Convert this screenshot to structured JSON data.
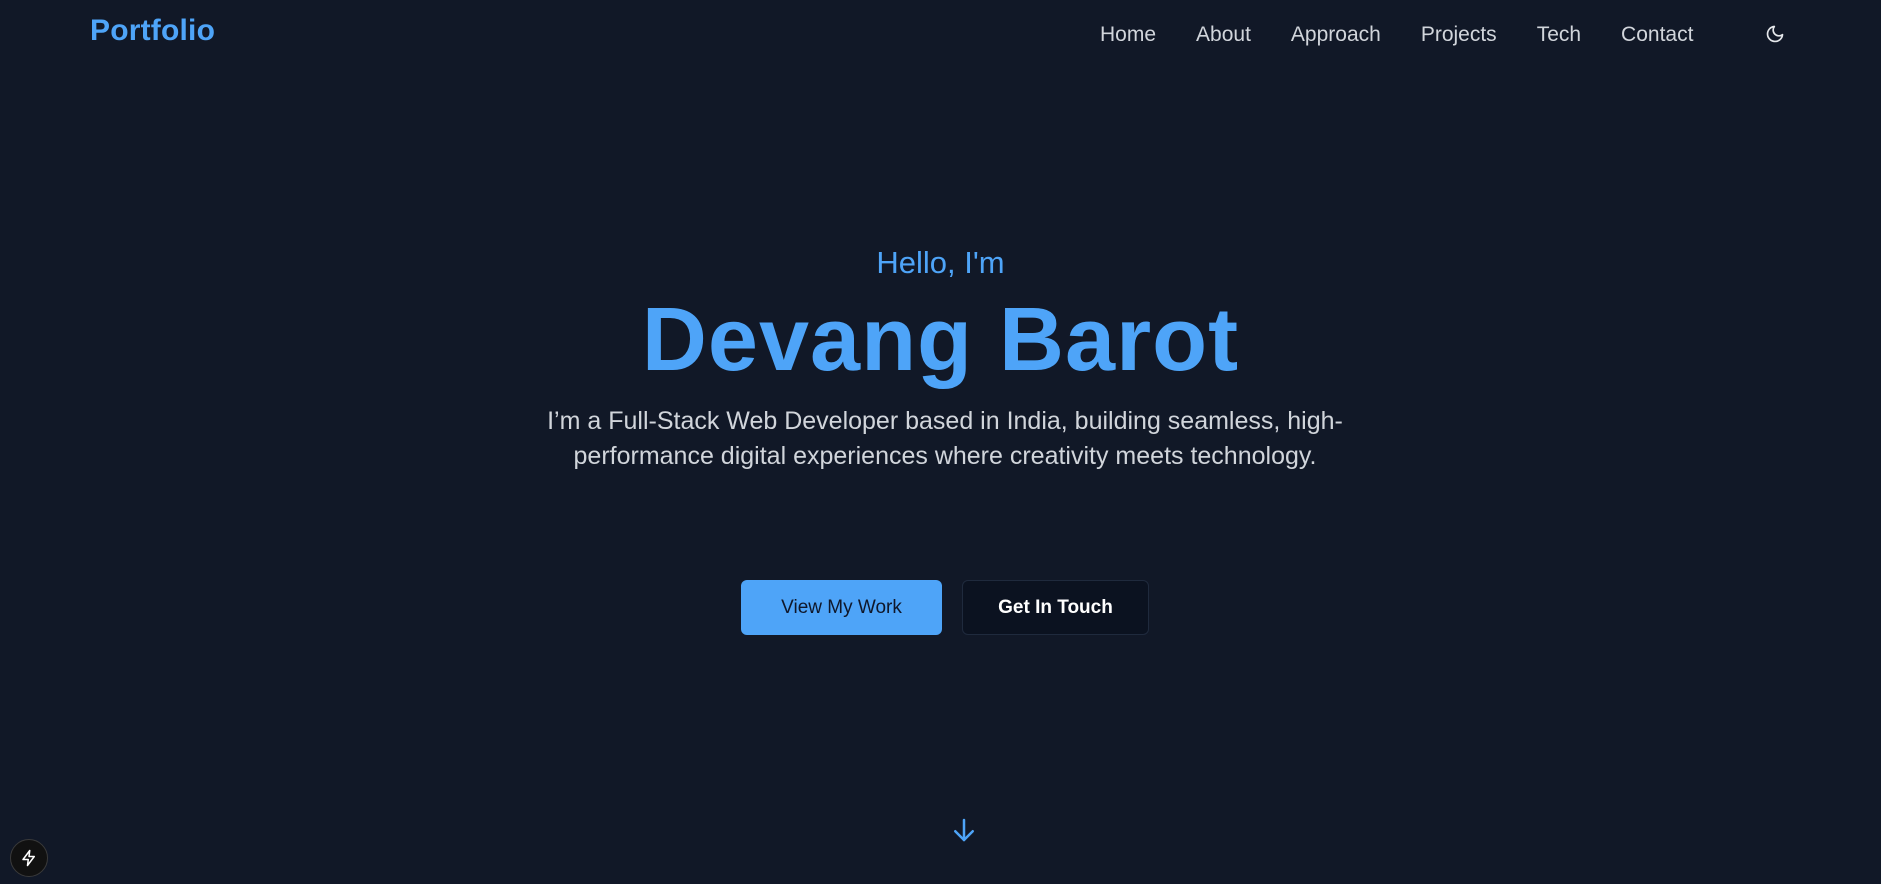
{
  "header": {
    "brand": "Portfolio",
    "nav": [
      {
        "label": "Home"
      },
      {
        "label": "About"
      },
      {
        "label": "Approach"
      },
      {
        "label": "Projects"
      },
      {
        "label": "Tech"
      },
      {
        "label": "Contact"
      }
    ],
    "theme_toggle_icon": "moon-icon"
  },
  "hero": {
    "greeting": "Hello, I'm",
    "name": "Devang Barot",
    "tagline": "I’m a Full-Stack Web Developer based in India, building seamless, high-performance digital experiences where creativity meets technology.",
    "primary_button": "View My Work",
    "secondary_button": "Get In Touch",
    "scroll_icon": "arrow-down-icon"
  },
  "dev_badge_icon": "lightning-icon",
  "colors": {
    "background": "#111827",
    "accent": "#4ea4f8",
    "text_muted": "#d1d5db"
  }
}
